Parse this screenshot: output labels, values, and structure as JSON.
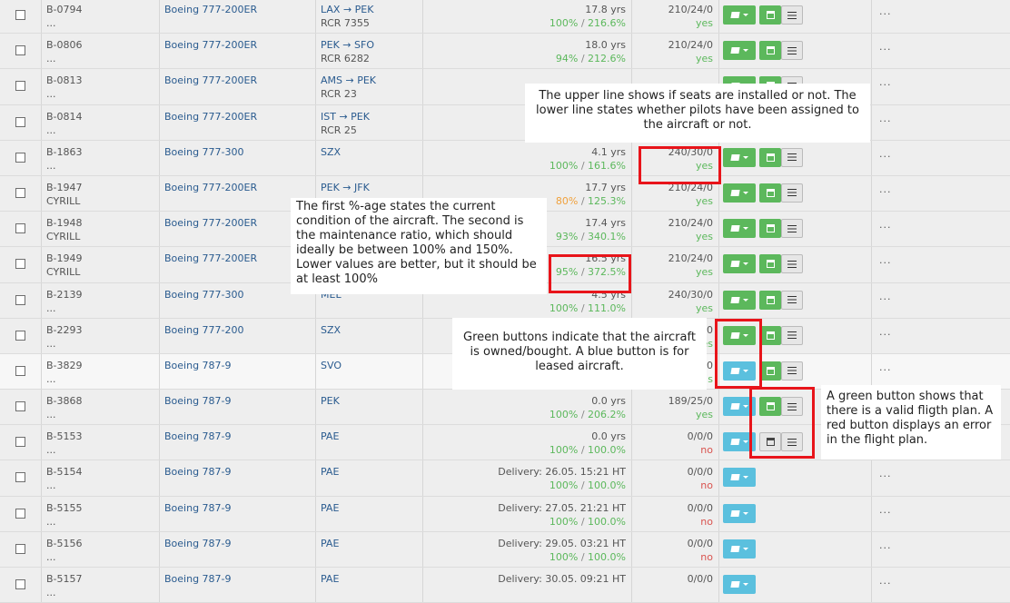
{
  "rows": [
    {
      "reg": "B-0794",
      "sub": "...",
      "model": "Boeing 777-200ER",
      "route": "LAX → PEK",
      "rcr": "RCR 7355",
      "age": "17.8 yrs",
      "cond": "100%",
      "ratio": "216.6%",
      "seats": "210/24/0",
      "pilots": "yes"
    },
    {
      "reg": "B-0806",
      "sub": "...",
      "model": "Boeing 777-200ER",
      "route": "PEK → SFO",
      "rcr": "RCR 6282",
      "age": "18.0 yrs",
      "cond": "94%",
      "ratio": "212.6%",
      "seats": "210/24/0",
      "pilots": "yes"
    },
    {
      "reg": "B-0813",
      "sub": "...",
      "model": "Boeing 777-200ER",
      "route": "AMS → PEK",
      "rcr": "RCR 23",
      "age": "",
      "cond": "",
      "ratio": "",
      "seats": "",
      "pilots": ""
    },
    {
      "reg": "B-0814",
      "sub": "...",
      "model": "Boeing 777-200ER",
      "route": "IST → PEK",
      "rcr": "RCR 25",
      "age": "",
      "cond": "",
      "ratio": "",
      "seats": "",
      "pilots": ""
    },
    {
      "reg": "B-1863",
      "sub": "...",
      "model": "Boeing 777-300",
      "route": "SZX",
      "rcr": "",
      "age": "4.1 yrs",
      "cond": "100%",
      "ratio": "161.6%",
      "seats": "240/30/0",
      "pilots": "yes"
    },
    {
      "reg": "B-1947",
      "sub": "CYRILL",
      "model": "Boeing 777-200ER",
      "route": "PEK → JFK",
      "rcr": "",
      "age": "17.7 yrs",
      "cond": "80%",
      "ratio": "125.3%",
      "seats": "210/24/0",
      "pilots": "yes"
    },
    {
      "reg": "B-1948",
      "sub": "CYRILL",
      "model": "Boeing 777-200ER",
      "route": "",
      "rcr": "",
      "age": "17.4 yrs",
      "cond": "93%",
      "ratio": "340.1%",
      "seats": "210/24/0",
      "pilots": "yes"
    },
    {
      "reg": "B-1949",
      "sub": "CYRILL",
      "model": "Boeing 777-200ER",
      "route": "",
      "rcr": "",
      "age": "16.5 yrs",
      "cond": "95%",
      "ratio": "372.5%",
      "seats": "210/24/0",
      "pilots": "yes"
    },
    {
      "reg": "B-2139",
      "sub": "...",
      "model": "Boeing 777-300",
      "route": "MEL",
      "rcr": "",
      "age": "4.5 yrs",
      "cond": "100%",
      "ratio": "111.0%",
      "seats": "240/30/0",
      "pilots": "yes"
    },
    {
      "reg": "B-2293",
      "sub": "...",
      "model": "Boeing 777-200",
      "route": "SZX",
      "rcr": "",
      "age": "",
      "cond": "",
      "ratio": "",
      "seats": "0",
      "pilots": "es"
    },
    {
      "reg": "B-3829",
      "sub": "...",
      "model": "Boeing 787-9",
      "route": "SVO",
      "rcr": "",
      "age": "",
      "cond": "",
      "ratio": "",
      "seats": "0",
      "pilots": "s"
    },
    {
      "reg": "B-3868",
      "sub": "...",
      "model": "Boeing 787-9",
      "route": "PEK",
      "rcr": "",
      "age": "0.0 yrs",
      "cond": "100%",
      "ratio": "206.2%",
      "seats": "189/25/0",
      "pilots": "yes"
    },
    {
      "reg": "B-5153",
      "sub": "...",
      "model": "Boeing 787-9",
      "route": "PAE",
      "rcr": "",
      "age": "0.0 yrs",
      "cond": "100%",
      "ratio": "100.0%",
      "seats": "0/0/0",
      "pilots": "no"
    },
    {
      "reg": "B-5154",
      "sub": "...",
      "model": "Boeing 787-9",
      "route": "PAE",
      "rcr": "",
      "age": "Delivery: 26.05. 15:21 HT",
      "cond": "100%",
      "ratio": "100.0%",
      "seats": "0/0/0",
      "pilots": "no"
    },
    {
      "reg": "B-5155",
      "sub": "...",
      "model": "Boeing 787-9",
      "route": "PAE",
      "rcr": "",
      "age": "Delivery: 27.05. 21:21 HT",
      "cond": "100%",
      "ratio": "100.0%",
      "seats": "0/0/0",
      "pilots": "no"
    },
    {
      "reg": "B-5156",
      "sub": "...",
      "model": "Boeing 787-9",
      "route": "PAE",
      "rcr": "",
      "age": "Delivery: 29.05. 03:21 HT",
      "cond": "100%",
      "ratio": "100.0%",
      "seats": "0/0/0",
      "pilots": "no"
    },
    {
      "reg": "B-5157",
      "sub": "...",
      "model": "Boeing 787-9",
      "route": "PAE",
      "rcr": "",
      "age": "Delivery: 30.05. 09:21 HT",
      "cond": "",
      "ratio": "",
      "seats": "0/0/0",
      "pilots": ""
    }
  ],
  "more_label": "...",
  "notes": {
    "seats": "The upper line shows if seats are installed or not. The lower line states whether pilots have been assigned to the aircraft or not.",
    "condition": "The first %-age states the current condition of the aircraft. The second is the maintenance ratio, which should ideally be between 100% and 150%. Lower values are better, but it should be at least 100%",
    "ownership": "Green buttons indicate that the aircraft is owned/bought. A blue button is for leased aircraft.",
    "flightplan": "A green button shows that there is a valid fligth plan. A red button displays an error in the flight plan."
  }
}
